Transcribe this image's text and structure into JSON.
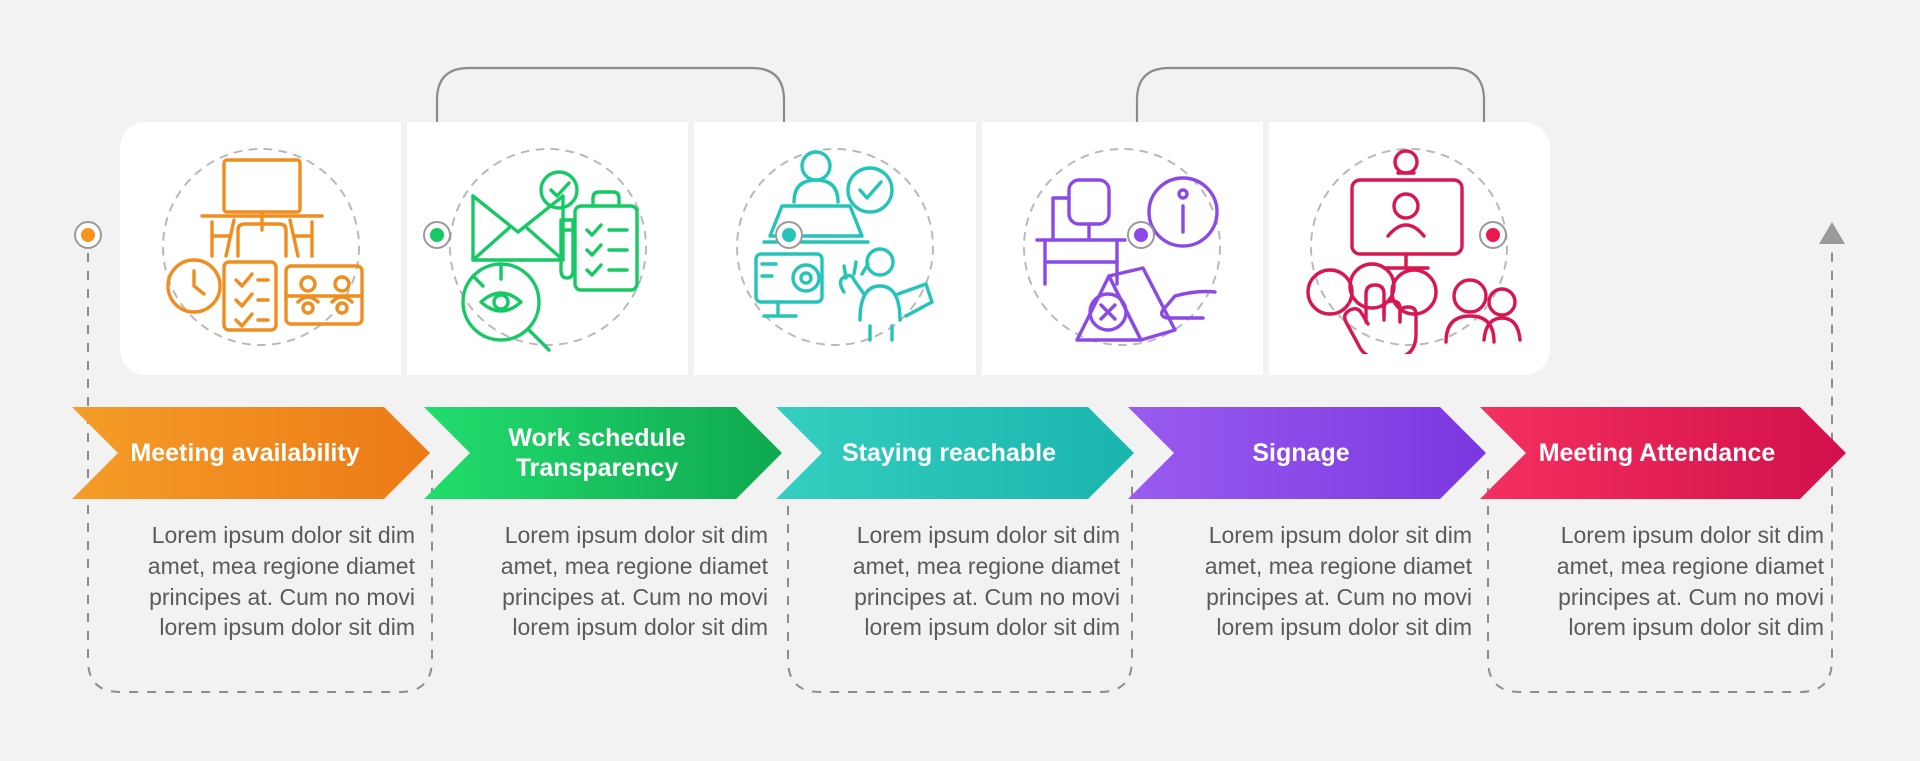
{
  "meta": {
    "background_color": "#f2f2f2",
    "card_background": "#ffffff",
    "connector_color": "#8c8c8c",
    "body_text_color": "#5a5a5a"
  },
  "steps": [
    {
      "id": "meeting-availability",
      "label": "Meeting availability",
      "color": "#f08c1e",
      "gradient_from": "#f59c28",
      "gradient_to": "#ec7a16",
      "icon_name": "meeting-availability-icon",
      "description": "Lorem ipsum dolor sit dim amet, mea regione diamet principes at. Cum no movi lorem ipsum dolor sit dim"
    },
    {
      "id": "work-schedule-transparency",
      "label": "Work schedule Transparency",
      "color": "#17c964",
      "gradient_from": "#22dd6e",
      "gradient_to": "#0fa84f",
      "icon_name": "work-schedule-transparency-icon",
      "description": "Lorem ipsum dolor sit dim amet, mea regione diamet principes at. Cum no movi lorem ipsum dolor sit dim"
    },
    {
      "id": "staying-reachable",
      "label": "Staying reachable",
      "color": "#25c4b8",
      "gradient_from": "#34cfc0",
      "gradient_to": "#19b5ae",
      "icon_name": "staying-reachable-icon",
      "description": "Lorem ipsum dolor sit dim amet, mea regione diamet principes at. Cum no movi lorem ipsum dolor sit dim"
    },
    {
      "id": "signage",
      "label": "Signage",
      "color": "#8b4ae8",
      "gradient_from": "#9a5bf0",
      "gradient_to": "#7b37df",
      "icon_name": "signage-icon",
      "description": "Lorem ipsum dolor sit dim amet, mea regione diamet principes at. Cum no movi lorem ipsum dolor sit dim"
    },
    {
      "id": "meeting-attendance",
      "label": "Meeting Attendance",
      "color": "#e8194e",
      "gradient_from": "#f4305f",
      "gradient_to": "#d2104a",
      "icon_name": "meeting-attendance-icon",
      "description": "Lorem ipsum dolor sit dim amet, mea regione diamet principes at. Cum no movi lorem ipsum dolor sit dim"
    }
  ],
  "markers": {
    "dot_colors": [
      "#f7941e",
      "#17c964",
      "#25c4b8",
      "#8b4ae8",
      "#e8194e"
    ],
    "end_arrow_color": "#9a9a9a"
  }
}
